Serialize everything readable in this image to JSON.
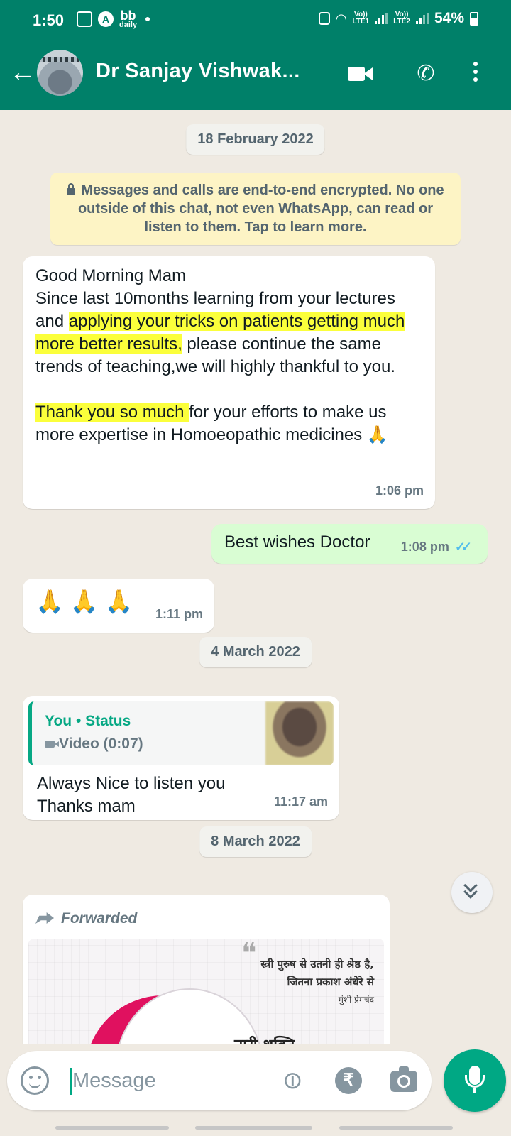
{
  "status_bar": {
    "time": "1:50",
    "bb_top": "bb",
    "bb_bottom": "daily",
    "sim1_top": "Vo))",
    "sim1_bottom": "LTE1",
    "sim2_top": "Vo))",
    "sim2_bottom": "LTE2",
    "battery": "54%"
  },
  "header": {
    "contact_name": "Dr Sanjay Vishwak..."
  },
  "chat": {
    "date_1": "18 February 2022",
    "encryption_notice": "Messages and calls are end-to-end encrypted. No one outside of this chat, not even WhatsApp, can read or listen to them. Tap to learn more.",
    "msg1": {
      "line1": "Good Morning Mam",
      "p1_a": "Since last 10months learning from your lectures and ",
      "p1_hl": "applying your tricks on patients getting much more better results,",
      "p1_b": " please continue the same trends of teaching,we will highly thankful to you.",
      "p2_hl": "Thank you so much ",
      "p2_b": "for your efforts to make us more expertise in Homoeopathic medicines 🙏",
      "time": "1:06 pm"
    },
    "msg2": {
      "text": "Best wishes Doctor",
      "time": "1:08 pm",
      "ticks": "✓✓"
    },
    "msg3": {
      "text": "🙏 🙏 🙏",
      "time": "1:11 pm"
    },
    "date_2": "4 March 2022",
    "msg4": {
      "quote_title": "You • Status",
      "quote_sub": "Video (0:07)",
      "line1": "Always Nice to listen you",
      "line2": "Thanks mam",
      "time": "11:17 am"
    },
    "date_3": "8 March 2022",
    "msg5": {
      "forwarded": "Forwarded",
      "poster_quote_1": "स्त्री पुरुष से उतनी ही श्रेष्ठ है,",
      "poster_quote_2": "जितना प्रकाश अंधेरे से",
      "poster_author": "- मुंशी प्रेमचंद",
      "poster_title": "नारी शक्ति"
    }
  },
  "input": {
    "placeholder": "Message"
  },
  "colors": {
    "header": "#008069",
    "outgoing_bubble": "#d9fdd3",
    "highlight": "#fbff3b",
    "accent": "#00a884",
    "chat_bg": "#efeae2"
  },
  "icons": [
    "back-arrow-icon",
    "video-call-icon",
    "phone-icon",
    "more-options-icon",
    "lock-icon",
    "double-check-icon",
    "video-icon",
    "forward-icon",
    "scroll-down-icon",
    "emoji-icon",
    "attach-icon",
    "rupee-icon",
    "camera-icon",
    "mic-icon"
  ]
}
